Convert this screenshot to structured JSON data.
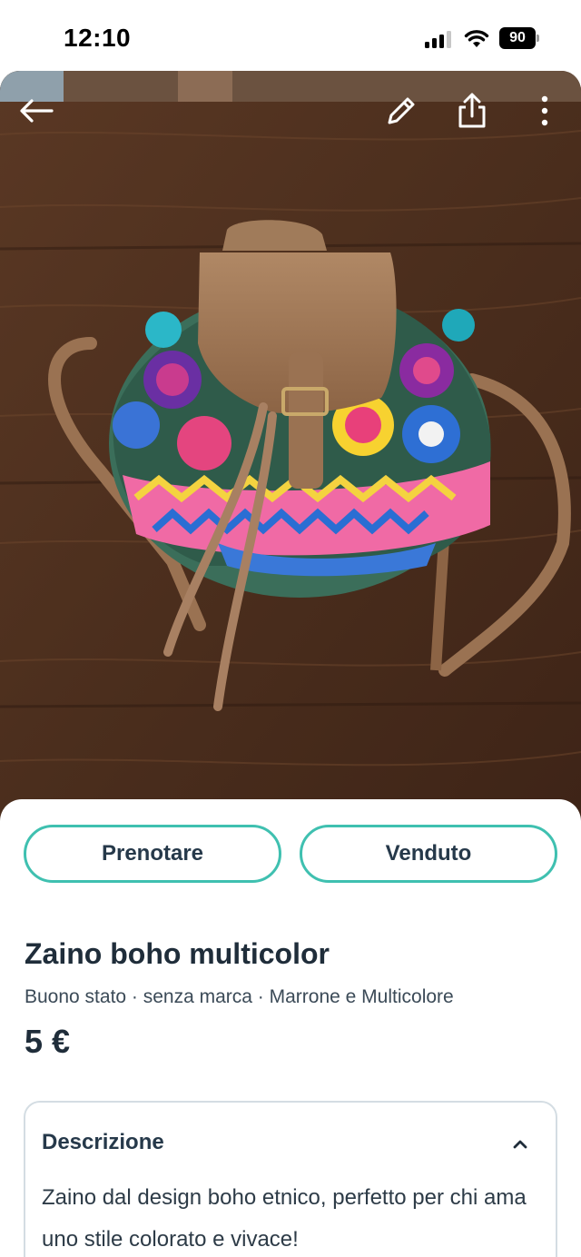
{
  "status_bar": {
    "time": "12:10",
    "battery": "90",
    "icons": [
      "signal-icon",
      "wifi-icon",
      "battery-icon"
    ]
  },
  "photo": {
    "description": "product-photo",
    "page_count": 3,
    "active_page": 1
  },
  "top_bar": {
    "icons": [
      "back-arrow-icon",
      "edit-pencil-icon",
      "share-icon",
      "more-vertical-icon"
    ]
  },
  "actions": {
    "reserve_label": "Prenotare",
    "sold_label": "Venduto"
  },
  "listing": {
    "title": "Zaino boho multicolor",
    "details": "Buono stato · senza marca · Marrone e Multicolore",
    "price": "5 €"
  },
  "description": {
    "heading": "Descrizione",
    "text": "Zaino dal design boho etnico, perfetto per chi ama uno stile colorato e vivace!"
  },
  "colors": {
    "accent": "#3fc0b0",
    "text_dark": "#1f2d3a"
  }
}
